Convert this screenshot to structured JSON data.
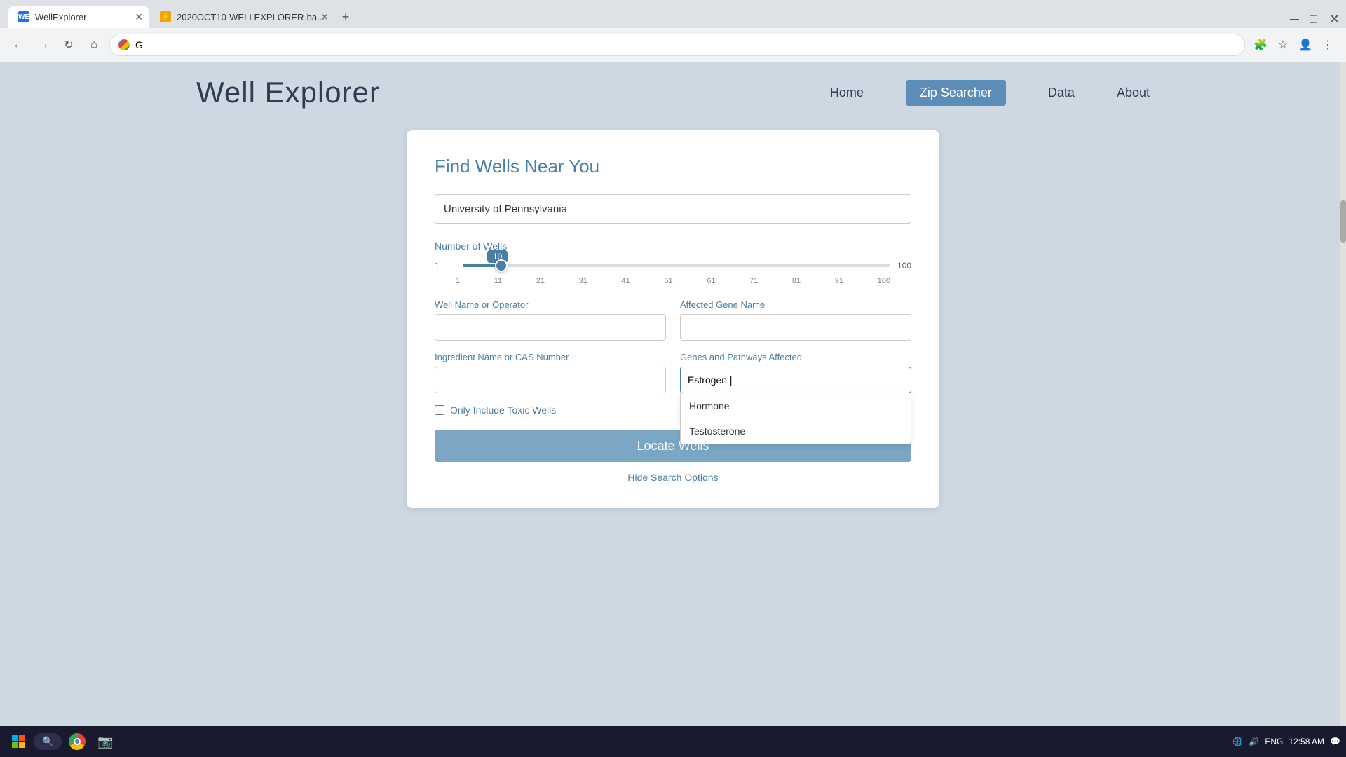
{
  "browser": {
    "tab1": {
      "label": "WellExplorer",
      "favicon": "WE"
    },
    "tab2": {
      "label": "2020OCT10-WELLEXPLORER-ba..."
    },
    "address": "G"
  },
  "header": {
    "logo": "Well Explorer",
    "nav": {
      "home": "Home",
      "zip_searcher": "Zip Searcher",
      "data": "Data",
      "about": "About"
    }
  },
  "card": {
    "title": "Find Wells Near You",
    "location_placeholder": "University of Pennsylvania",
    "location_value": "University of Pennsylvania",
    "number_of_wells_label": "Number of Wells",
    "slider": {
      "min": "1",
      "max": "100",
      "value": "10",
      "ticks": [
        "1",
        "11",
        "21",
        "31",
        "41",
        "51",
        "61",
        "71",
        "81",
        "91",
        "100"
      ]
    },
    "well_name_label": "Well Name or Operator",
    "well_name_placeholder": "",
    "affected_gene_label": "Affected Gene Name",
    "affected_gene_placeholder": "",
    "ingredient_label": "Ingredient Name or CAS Number",
    "ingredient_placeholder": "",
    "genes_pathways_label": "Genes and Pathways Affected",
    "genes_pathways_value": "Estrogen |",
    "dropdown_items": [
      "Hormone",
      "Testosterone"
    ],
    "checkbox_label": "Only Include Toxic Wells",
    "locate_button": "Locate Wells",
    "hide_search": "Hide Search Options"
  },
  "taskbar": {
    "time": "12:58 AM",
    "date": "",
    "lang": "ENG"
  }
}
